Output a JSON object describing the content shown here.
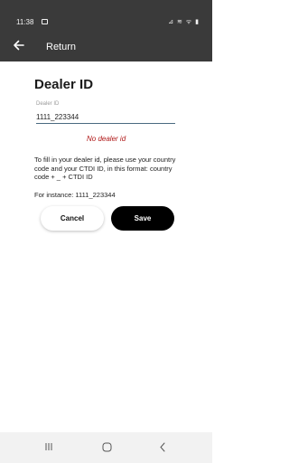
{
  "status_bar": {
    "time": "11:38",
    "indicators": "⊿ ≋ ᯤ ▮"
  },
  "app_bar": {
    "title": "Return",
    "back_icon": "arrow-left-icon"
  },
  "form": {
    "title": "Dealer ID",
    "field_label": "Dealer ID",
    "field_value": "1111_223344",
    "error": "No dealer id",
    "help_text": "To fill in your dealer id, please use your country code and your CTDI ID, in this format: country code + _ + CTDI ID",
    "example": "For instance: 1111_223344"
  },
  "buttons": {
    "cancel_label": "Cancel",
    "save_label": "Save"
  },
  "nav_bar": {
    "icons": [
      "recents-icon",
      "home-icon",
      "back-icon"
    ]
  },
  "colors": {
    "app_bar": "#3a3a3a",
    "error": "#b01818",
    "save_button": "#000000",
    "field_underline": "#4a6a80"
  }
}
